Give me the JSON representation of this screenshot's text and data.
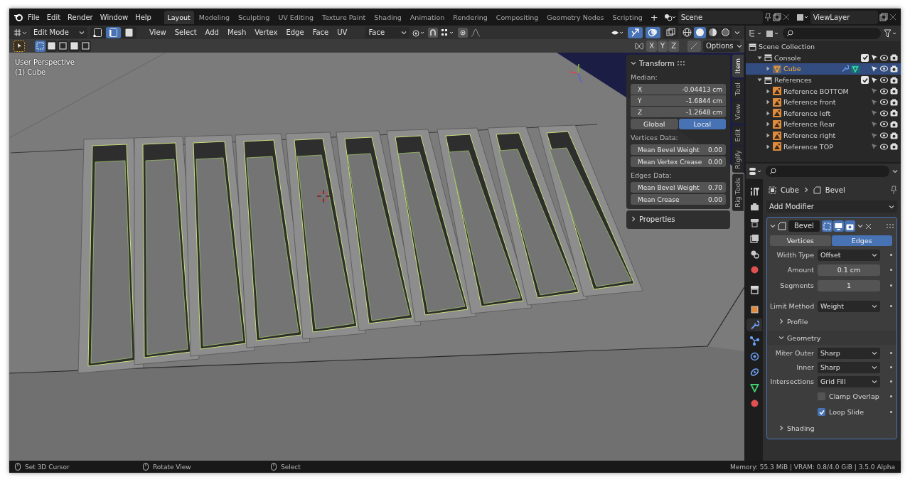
{
  "menu": [
    "File",
    "Edit",
    "Render",
    "Window",
    "Help"
  ],
  "workspaces": [
    {
      "label": "Layout",
      "selected": true
    },
    {
      "label": "Modeling",
      "selected": false
    },
    {
      "label": "Sculpting",
      "selected": false
    },
    {
      "label": "UV Editing",
      "selected": false
    },
    {
      "label": "Texture Paint",
      "selected": false
    },
    {
      "label": "Shading",
      "selected": false
    },
    {
      "label": "Animation",
      "selected": false
    },
    {
      "label": "Rendering",
      "selected": false
    },
    {
      "label": "Compositing",
      "selected": false
    },
    {
      "label": "Geometry Nodes",
      "selected": false
    },
    {
      "label": "Scripting",
      "selected": false
    }
  ],
  "add_workspace": "+",
  "scene": {
    "name": "Scene"
  },
  "view_layer": {
    "name": "ViewLayer"
  },
  "viewport_header": {
    "mode": "Edit Mode",
    "select_modes": [
      {
        "kind": "vertex",
        "selected": false
      },
      {
        "kind": "edge",
        "selected": true
      },
      {
        "kind": "face",
        "selected": false
      }
    ],
    "menus": [
      "View",
      "Select",
      "Add",
      "Mesh",
      "Vertex",
      "Edge",
      "Face",
      "UV"
    ],
    "orientation": "Face",
    "toggles": [
      {
        "kind": "gizmo",
        "on": true
      },
      {
        "kind": "overlay",
        "on": true
      },
      {
        "kind": "xray",
        "on": false
      }
    ],
    "shading_modes": [
      {
        "kind": "wireframe",
        "selected": false
      },
      {
        "kind": "solid",
        "selected": true
      },
      {
        "kind": "material",
        "selected": false
      },
      {
        "kind": "rendered",
        "selected": false
      }
    ]
  },
  "tool_row": {
    "select_modes": [
      {
        "selected": true
      },
      {
        "selected": false
      },
      {
        "selected": false
      },
      {
        "selected": false
      },
      {
        "selected": false
      }
    ],
    "axes": [
      "X",
      "Y",
      "Z"
    ],
    "options": "Options"
  },
  "viewport": {
    "info": [
      "User Perspective",
      "(1) Cube"
    ]
  },
  "n_panel": {
    "title": "Transform",
    "expanded": true,
    "median_label": "Median:",
    "fields": [
      {
        "label": "X",
        "value": "-0.04413 cm"
      },
      {
        "label": "Y",
        "value": "-1.6844 cm"
      },
      {
        "label": "Z",
        "value": "-1.2648 cm"
      }
    ],
    "space": [
      {
        "label": "Global",
        "selected": false
      },
      {
        "label": "Local",
        "selected": true
      }
    ],
    "groups": [
      {
        "title": "Vertices Data:",
        "rows": [
          {
            "label": "Mean Bevel Weight",
            "value": "0.00"
          },
          {
            "label": "Mean Vertex Crease",
            "value": "0.00"
          }
        ]
      },
      {
        "title": "Edges Data:",
        "rows": [
          {
            "label": "Mean Bevel Weight",
            "value": "0.70"
          },
          {
            "label": "Mean Crease",
            "value": "0.00"
          }
        ]
      }
    ],
    "collapsed_panel": {
      "title": "Properties",
      "expanded": false
    }
  },
  "side_tabs": [
    {
      "label": "Item",
      "selected": true
    },
    {
      "label": "Tool",
      "selected": false
    },
    {
      "label": "View",
      "selected": false
    },
    {
      "label": "Edit",
      "selected": false
    },
    {
      "label": "Rigify",
      "selected": false
    },
    {
      "label": "Rig Tools",
      "selected": false
    }
  ],
  "outliner": {
    "root": {
      "label": "Scene Collection",
      "children": [
        {
          "label": "Console",
          "kind": "collection",
          "expanded": true,
          "checked": true,
          "selected": false,
          "children": [
            {
              "label": "Cube",
              "kind": "mesh",
              "expanded": false,
              "selected": true
            }
          ]
        },
        {
          "label": "References",
          "kind": "collection",
          "expanded": true,
          "checked": true,
          "selected": false,
          "children": [
            {
              "label": "Reference BOTTOM",
              "kind": "image",
              "expanded": false,
              "selected": false
            },
            {
              "label": "Reference front",
              "kind": "image",
              "expanded": false,
              "selected": false
            },
            {
              "label": "Reference left",
              "kind": "image",
              "expanded": false,
              "selected": false
            },
            {
              "label": "Reference Rear",
              "kind": "image",
              "expanded": false,
              "selected": false
            },
            {
              "label": "Reference right",
              "kind": "image",
              "expanded": false,
              "selected": false
            },
            {
              "label": "Reference TOP",
              "kind": "image",
              "expanded": false,
              "selected": false
            }
          ]
        }
      ]
    }
  },
  "properties": {
    "tabs": [
      {
        "kind": "tool",
        "selected": false
      },
      {
        "kind": "render",
        "selected": false
      },
      {
        "kind": "output",
        "selected": false
      },
      {
        "kind": "view_layer",
        "selected": false
      },
      {
        "kind": "scene",
        "selected": false
      },
      {
        "kind": "world",
        "selected": false
      },
      {
        "kind": "collection",
        "selected": false
      },
      {
        "kind": "object",
        "selected": false
      },
      {
        "kind": "modifiers",
        "selected": true
      },
      {
        "kind": "particles",
        "selected": false
      },
      {
        "kind": "physics",
        "selected": false
      },
      {
        "kind": "constraints",
        "selected": false
      },
      {
        "kind": "data",
        "selected": false
      },
      {
        "kind": "material",
        "selected": false
      }
    ],
    "breadcrumb": [
      "Cube",
      "Bevel"
    ],
    "add_modifier": "Add Modifier",
    "modifier": {
      "name": "Bevel",
      "expanded": true,
      "toggles": [
        {
          "kind": "edit_mode",
          "on": true
        },
        {
          "kind": "viewport",
          "on": true
        },
        {
          "kind": "render",
          "on": true
        }
      ],
      "affect": [
        {
          "label": "Vertices",
          "selected": false
        },
        {
          "label": "Edges",
          "selected": true
        }
      ],
      "rows": [
        {
          "kind": "dropdown",
          "label": "Width Type",
          "value": "Offset"
        },
        {
          "kind": "number",
          "label": "Amount",
          "value": "0.1 cm"
        },
        {
          "kind": "number",
          "label": "Segments",
          "value": "1"
        },
        {
          "kind": "dropdown",
          "label": "Limit Method",
          "value": "Weight"
        },
        {
          "kind": "subpanel",
          "label": "Profile",
          "expanded": false
        },
        {
          "kind": "subpanel",
          "label": "Geometry",
          "expanded": true
        },
        {
          "kind": "dropdown",
          "label": "Miter Outer",
          "value": "Sharp"
        },
        {
          "kind": "dropdown",
          "label": "Inner",
          "value": "Sharp"
        },
        {
          "kind": "dropdown",
          "label": "Intersections",
          "value": "Grid Fill"
        },
        {
          "kind": "checkbox",
          "label": "Clamp Overlap",
          "checked": false
        },
        {
          "kind": "checkbox",
          "label": "Loop Slide",
          "checked": true
        },
        {
          "kind": "subpanel",
          "label": "Shading",
          "expanded": false
        }
      ]
    }
  },
  "status_bar": {
    "hints": [
      "Set 3D Cursor",
      "Rotate View",
      "Select"
    ],
    "info": "Memory: 55.3 MiB | VRAM: 0.8/4.0 GiB | 3.5.0 Alpha"
  }
}
